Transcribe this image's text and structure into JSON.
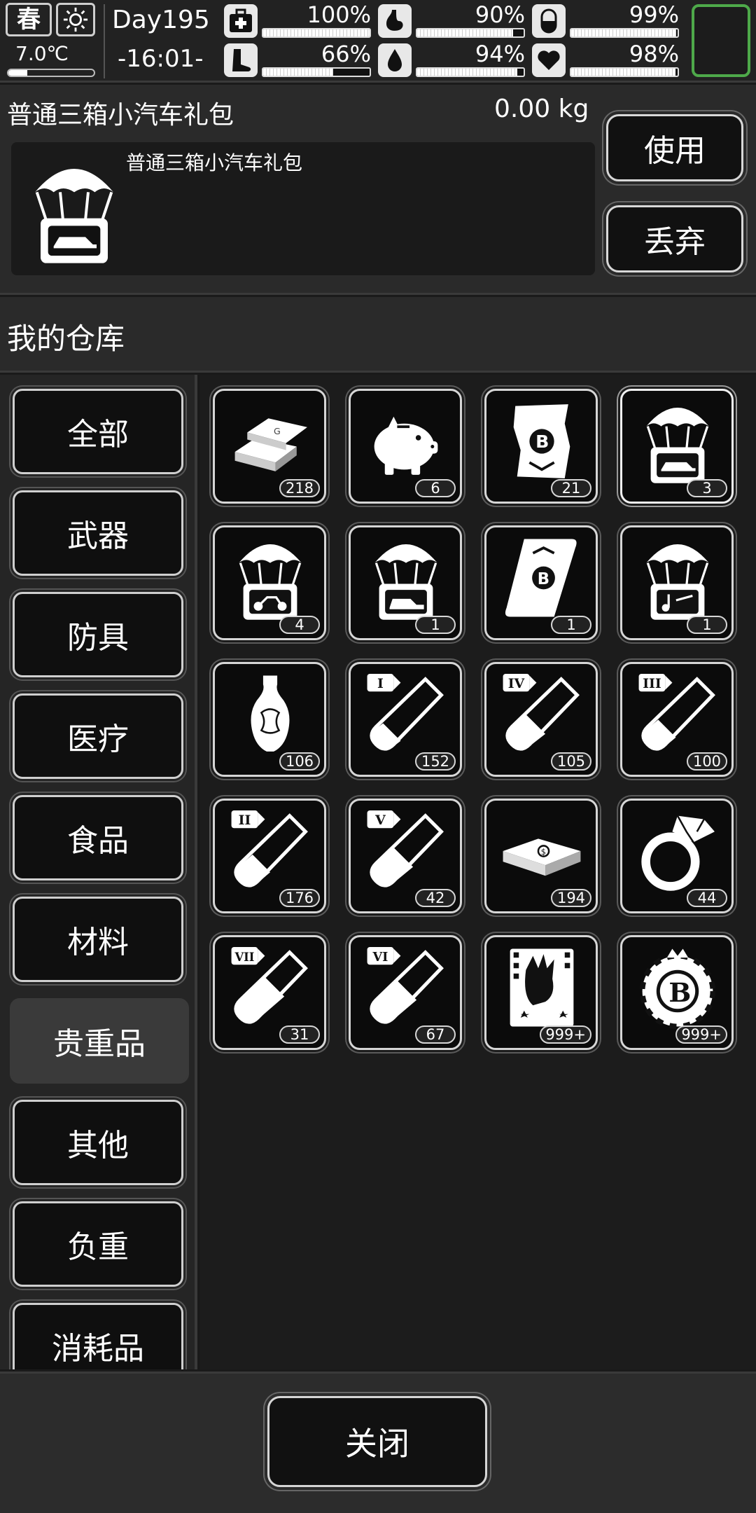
{
  "status": {
    "season": "春",
    "temperature": "7.0℃",
    "temperature_level": 0.22,
    "day": "Day195",
    "time": "-16:01-",
    "stats": [
      {
        "icon": "first-aid-icon",
        "value": "100%",
        "level": 1.0
      },
      {
        "icon": "stomach-icon",
        "value": "90%",
        "level": 0.9
      },
      {
        "icon": "pill-icon",
        "value": "99%",
        "level": 0.99
      },
      {
        "icon": "foot-icon",
        "value": "66%",
        "level": 0.66
      },
      {
        "icon": "water-drop-icon",
        "value": "94%",
        "level": 0.94
      },
      {
        "icon": "heart-icon",
        "value": "98%",
        "level": 0.98
      }
    ]
  },
  "detail": {
    "name": "普通三箱小汽车礼包",
    "weight": "0.00 kg",
    "description": "普通三箱小汽车礼包",
    "use_label": "使用",
    "discard_label": "丢弃"
  },
  "warehouse": {
    "title": "我的仓库",
    "categories": [
      "全部",
      "武器",
      "防具",
      "医疗",
      "食品",
      "材料",
      "贵重品",
      "其他",
      "负重",
      "消耗品"
    ],
    "active_category": "贵重品",
    "items": [
      {
        "icon": "gold-bar-icon",
        "count": "218"
      },
      {
        "icon": "piggy-bank-icon",
        "count": "6"
      },
      {
        "icon": "bitcoin-map-icon",
        "count": "21"
      },
      {
        "icon": "car-airdrop-icon",
        "count": "3",
        "selected": true
      },
      {
        "icon": "motorcycle-airdrop-icon",
        "count": "4"
      },
      {
        "icon": "car-airdrop-icon",
        "count": "1"
      },
      {
        "icon": "bitcoin-scroll-icon",
        "count": "1"
      },
      {
        "icon": "music-airdrop-icon",
        "count": "1"
      },
      {
        "icon": "vase-icon",
        "count": "106"
      },
      {
        "icon": "test-tube-icon",
        "numeral": "I",
        "count": "152"
      },
      {
        "icon": "test-tube-icon",
        "numeral": "IV",
        "count": "105"
      },
      {
        "icon": "test-tube-icon",
        "numeral": "III",
        "count": "100"
      },
      {
        "icon": "test-tube-icon",
        "numeral": "II",
        "count": "176"
      },
      {
        "icon": "test-tube-icon",
        "numeral": "V",
        "count": "42"
      },
      {
        "icon": "cash-stack-icon",
        "count": "194"
      },
      {
        "icon": "diamond-ring-icon",
        "count": "44"
      },
      {
        "icon": "test-tube-icon",
        "numeral": "VII",
        "count": "31"
      },
      {
        "icon": "test-tube-icon",
        "numeral": "VI",
        "count": "67"
      },
      {
        "icon": "zombie-card-icon",
        "count": "999+"
      },
      {
        "icon": "bitcoin-chip-icon",
        "count": "999+"
      }
    ]
  },
  "footer": {
    "close_label": "关闭"
  },
  "colors": {
    "minimap_border": "#4ea94a",
    "background": "#1a1a1a"
  }
}
